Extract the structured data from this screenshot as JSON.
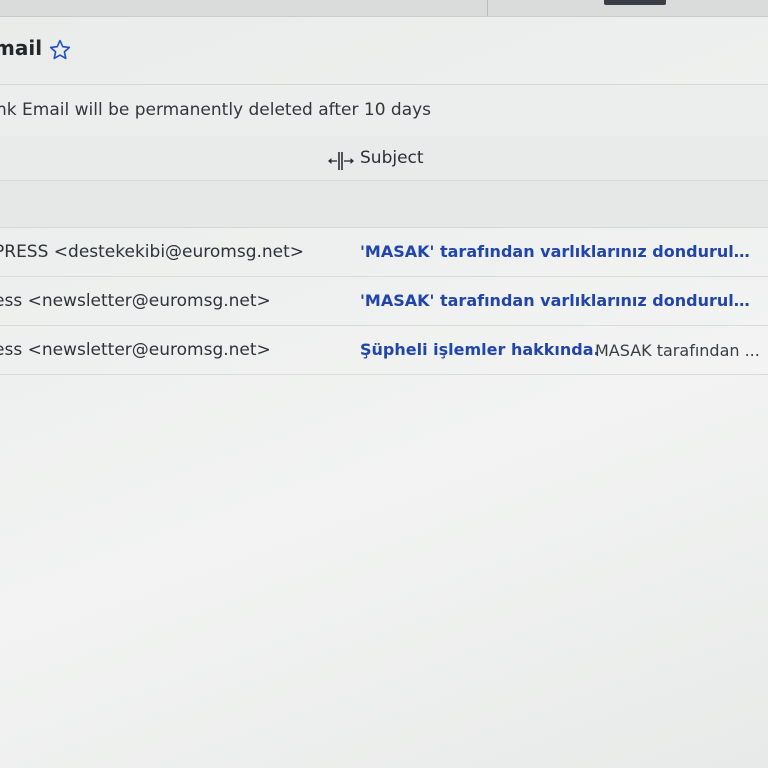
{
  "folder": {
    "title": "mail",
    "star_icon": "star-outline-icon",
    "accent": "#1f4fc4"
  },
  "notice": {
    "text": "nk Email will be permanently deleted after 10 days"
  },
  "columns": {
    "resize_icon": "column-resize-icon",
    "subject": "Subject"
  },
  "messages": [
    {
      "from": "PRESS <destekekibi@euromsg.net>",
      "subject": "'MASAK' tarafından varlıklarınız dondurulmuş...",
      "preview": ""
    },
    {
      "from": "ess <newsletter@euromsg.net>",
      "subject": "'MASAK' tarafından varlıklarınız dondurulmuş...",
      "preview": ""
    },
    {
      "from": "ess <newsletter@euromsg.net>",
      "subject": "Şüpheli işlemler hakkında.",
      "preview": "MASAK tarafından ..."
    }
  ],
  "colors": {
    "subject_link": "#2145a8",
    "background": "#eef0ef"
  }
}
